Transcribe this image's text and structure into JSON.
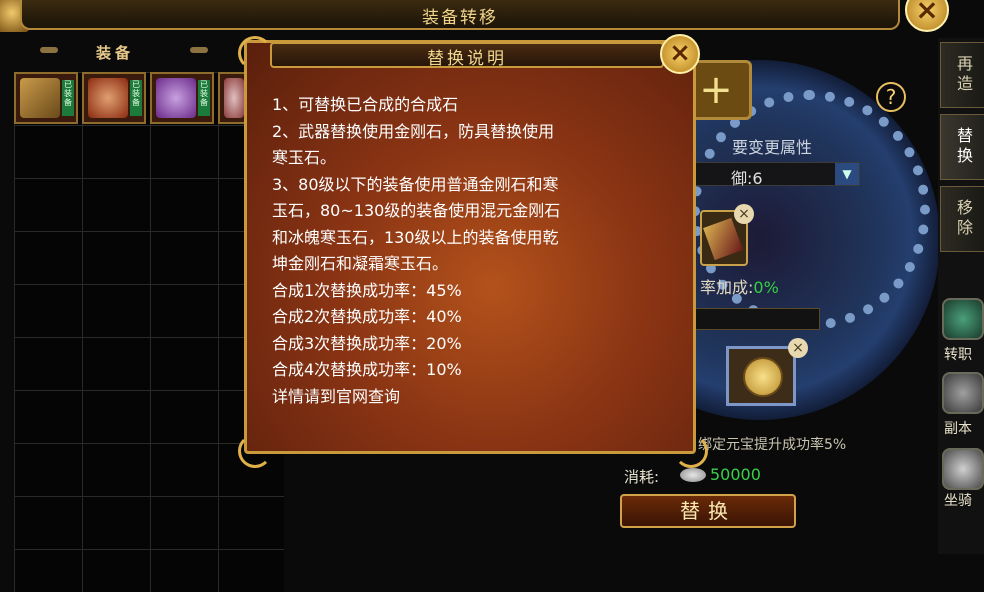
{
  "window": {
    "title": "装备转移"
  },
  "equip_panel": {
    "header": "装备",
    "slot_tags": [
      "已装备",
      "已装备",
      "已装备"
    ]
  },
  "tabs": [
    {
      "label": "再造",
      "active": false
    },
    {
      "label": "替换",
      "active": true
    },
    {
      "label": "移除",
      "active": false
    }
  ],
  "side_shortcuts": [
    "转职",
    "副本",
    "坐骑"
  ],
  "main": {
    "attr_label": "要变更属性",
    "attr_select_value": "御:6",
    "rate_label": "率加成:",
    "rate_value": "0%",
    "bind_hint": "绑定元宝提升成功率5%",
    "cost_label": "消耗:",
    "cost_value": "50000",
    "replace_button": "替换"
  },
  "popup": {
    "title": "替换说明",
    "lines": [
      "1、可替换已合成的合成石",
      "2、武器替换使用金刚石，防具替换使用",
      "寒玉石。",
      "3、80级以下的装备使用普通金刚石和寒",
      "玉石，80~130级的装备使用混元金刚石",
      "和冰魄寒玉石，130级以上的装备使用乾",
      "坤金刚石和凝霜寒玉石。",
      "合成1次替换成功率：45%",
      "合成2次替换成功率：40%",
      "合成3次替换成功率：20%",
      "合成4次替换成功率：10%",
      "详情请到官网查询"
    ]
  },
  "colors": {
    "accent_gold": "#c99a3c",
    "success_green": "#36d046",
    "popup_red": "#8a3414"
  },
  "icons": {
    "close": "close-icon",
    "help": "help-icon",
    "add": "plus-icon",
    "coin": "coin-icon",
    "dropdown": "chevron-down-icon"
  }
}
